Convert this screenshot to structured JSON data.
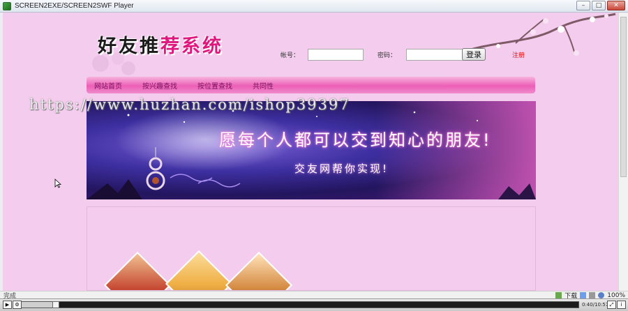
{
  "window": {
    "title": "SCREEN2EXE/SCREEN2SWF Player",
    "buttons": [
      "–",
      "□",
      "✕"
    ]
  },
  "site": {
    "logo_dark": "好友推",
    "logo_pink": "荐系统",
    "login": {
      "account_label": "帐号：",
      "account_value": "",
      "password_label": "密码：",
      "password_value": "",
      "submit_label": "登录",
      "register_label": "注册"
    },
    "nav": [
      "网站首页",
      "按兴趣查找",
      "按位置查找",
      "共同性"
    ],
    "watermark": "https://www.huzhan.com/ishop39397",
    "banner": {
      "title": "愿每个人都可以交到知心的朋友!",
      "subtitle": "交友网帮你实现!"
    }
  },
  "statusbar": {
    "status": "完成",
    "download": "下载",
    "zoom": "100%"
  },
  "player": {
    "time": "0:40/10:57",
    "progress": 0.061
  },
  "colors": {
    "page_bg": "#f4cdee",
    "nav_pink": "#ec5fb6",
    "logo_pink": "#e0167f",
    "register_red": "#e20f0f"
  }
}
